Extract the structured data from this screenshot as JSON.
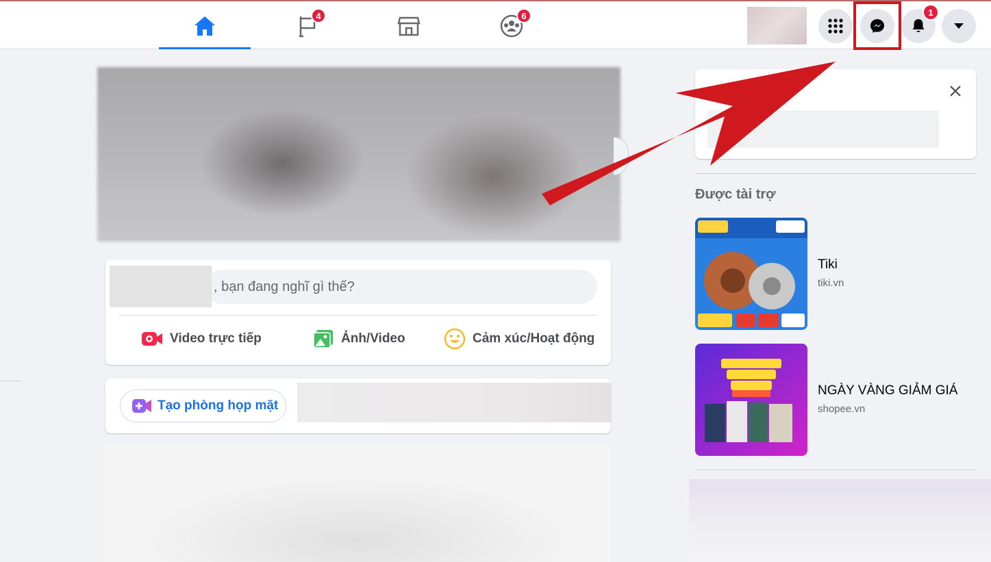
{
  "topbar": {
    "tabs": [
      {
        "name": "home",
        "icon": "home-icon",
        "badge": null,
        "active": true
      },
      {
        "name": "pages",
        "icon": "flag-icon",
        "badge": "4",
        "active": false
      },
      {
        "name": "marketplace",
        "icon": "store-icon",
        "badge": null,
        "active": false
      },
      {
        "name": "groups",
        "icon": "groups-icon",
        "badge": "6",
        "active": false
      }
    ],
    "right": {
      "menu_icon": "grid-menu-icon",
      "messenger_icon": "messenger-icon",
      "notifications_icon": "bell-icon",
      "notifications_badge": "1",
      "account_icon": "caret-down-icon"
    }
  },
  "composer": {
    "placeholder": ", bạn đang nghĩ gì thế?",
    "actions": [
      {
        "label": "Video trực tiếp",
        "icon": "live-video-icon",
        "color": "#f02849"
      },
      {
        "label": "Ảnh/Video",
        "icon": "photo-icon",
        "color": "#45bd62"
      },
      {
        "label": "Cảm xúc/Hoạt động",
        "icon": "feeling-icon",
        "color": "#f7b928"
      }
    ]
  },
  "rooms": {
    "button_label": "Tạo phòng họp mặt",
    "icon": "video-plus-icon"
  },
  "sidebar": {
    "sponsored_label": "Được tài trợ",
    "ads": [
      {
        "title": "Tiki",
        "domain": "tiki.vn"
      },
      {
        "title": "NGÀY VÀNG GIẢM GIÁ",
        "domain": "shopee.vn"
      }
    ]
  },
  "colors": {
    "accent": "#1877f2",
    "badge": "#e41e3f",
    "highlight": "#d0191f"
  }
}
